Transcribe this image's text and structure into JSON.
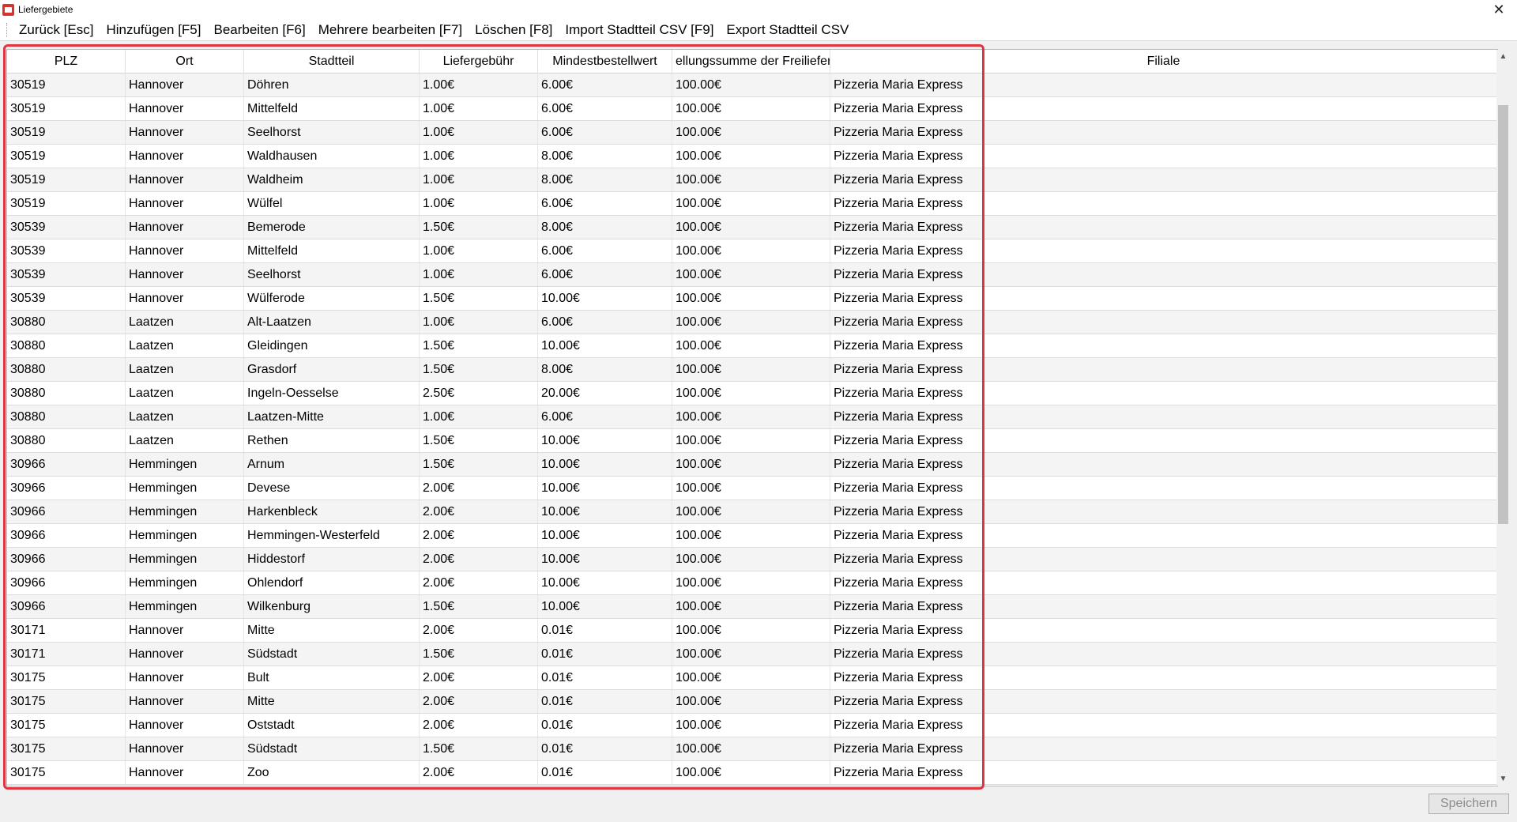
{
  "window": {
    "title": "Liefergebiete"
  },
  "menu": [
    "Zurück [Esc]",
    "Hinzufügen [F5]",
    "Bearbeiten [F6]",
    "Mehrere bearbeiten [F7]",
    "Löschen [F8]",
    "Import Stadtteil CSV [F9]",
    "Export Stadtteil CSV"
  ],
  "table": {
    "headers": [
      "PLZ",
      "Ort",
      "Stadtteil",
      "Liefergebühr",
      "Mindestbestellwert",
      "ellungssumme der Freiliefer",
      "Filiale"
    ],
    "rows": [
      [
        "30519",
        "Hannover",
        "Döhren",
        "1.00€",
        "6.00€",
        "100.00€",
        "Pizzeria Maria Express"
      ],
      [
        "30519",
        "Hannover",
        "Mittelfeld",
        "1.00€",
        "6.00€",
        "100.00€",
        "Pizzeria Maria Express"
      ],
      [
        "30519",
        "Hannover",
        "Seelhorst",
        "1.00€",
        "6.00€",
        "100.00€",
        "Pizzeria Maria Express"
      ],
      [
        "30519",
        "Hannover",
        "Waldhausen",
        "1.00€",
        "8.00€",
        "100.00€",
        "Pizzeria Maria Express"
      ],
      [
        "30519",
        "Hannover",
        "Waldheim",
        "1.00€",
        "8.00€",
        "100.00€",
        "Pizzeria Maria Express"
      ],
      [
        "30519",
        "Hannover",
        "Wülfel",
        "1.00€",
        "6.00€",
        "100.00€",
        "Pizzeria Maria Express"
      ],
      [
        "30539",
        "Hannover",
        "Bemerode",
        "1.50€",
        "8.00€",
        "100.00€",
        "Pizzeria Maria Express"
      ],
      [
        "30539",
        "Hannover",
        "Mittelfeld",
        "1.00€",
        "6.00€",
        "100.00€",
        "Pizzeria Maria Express"
      ],
      [
        "30539",
        "Hannover",
        "Seelhorst",
        "1.00€",
        "6.00€",
        "100.00€",
        "Pizzeria Maria Express"
      ],
      [
        "30539",
        "Hannover",
        "Wülferode",
        "1.50€",
        "10.00€",
        "100.00€",
        "Pizzeria Maria Express"
      ],
      [
        "30880",
        "Laatzen",
        "Alt-Laatzen",
        "1.00€",
        "6.00€",
        "100.00€",
        "Pizzeria Maria Express"
      ],
      [
        "30880",
        "Laatzen",
        "Gleidingen",
        "1.50€",
        "10.00€",
        "100.00€",
        "Pizzeria Maria Express"
      ],
      [
        "30880",
        "Laatzen",
        "Grasdorf",
        "1.50€",
        "8.00€",
        "100.00€",
        "Pizzeria Maria Express"
      ],
      [
        "30880",
        "Laatzen",
        "Ingeln-Oesselse",
        "2.50€",
        "20.00€",
        "100.00€",
        "Pizzeria Maria Express"
      ],
      [
        "30880",
        "Laatzen",
        "Laatzen-Mitte",
        "1.00€",
        "6.00€",
        "100.00€",
        "Pizzeria Maria Express"
      ],
      [
        "30880",
        "Laatzen",
        "Rethen",
        "1.50€",
        "10.00€",
        "100.00€",
        "Pizzeria Maria Express"
      ],
      [
        "30966",
        "Hemmingen",
        "Arnum",
        "1.50€",
        "10.00€",
        "100.00€",
        "Pizzeria Maria Express"
      ],
      [
        "30966",
        "Hemmingen",
        "Devese",
        "2.00€",
        "10.00€",
        "100.00€",
        "Pizzeria Maria Express"
      ],
      [
        "30966",
        "Hemmingen",
        "Harkenbleck",
        "2.00€",
        "10.00€",
        "100.00€",
        "Pizzeria Maria Express"
      ],
      [
        "30966",
        "Hemmingen",
        "Hemmingen-Westerfeld",
        "2.00€",
        "10.00€",
        "100.00€",
        "Pizzeria Maria Express"
      ],
      [
        "30966",
        "Hemmingen",
        "Hiddestorf",
        "2.00€",
        "10.00€",
        "100.00€",
        "Pizzeria Maria Express"
      ],
      [
        "30966",
        "Hemmingen",
        "Ohlendorf",
        "2.00€",
        "10.00€",
        "100.00€",
        "Pizzeria Maria Express"
      ],
      [
        "30966",
        "Hemmingen",
        "Wilkenburg",
        "1.50€",
        "10.00€",
        "100.00€",
        "Pizzeria Maria Express"
      ],
      [
        "30171",
        "Hannover",
        "Mitte",
        "2.00€",
        "0.01€",
        "100.00€",
        "Pizzeria Maria Express"
      ],
      [
        "30171",
        "Hannover",
        "Südstadt",
        "1.50€",
        "0.01€",
        "100.00€",
        "Pizzeria Maria Express"
      ],
      [
        "30175",
        "Hannover",
        "Bult",
        "2.00€",
        "0.01€",
        "100.00€",
        "Pizzeria Maria Express"
      ],
      [
        "30175",
        "Hannover",
        "Mitte",
        "2.00€",
        "0.01€",
        "100.00€",
        "Pizzeria Maria Express"
      ],
      [
        "30175",
        "Hannover",
        "Oststadt",
        "2.00€",
        "0.01€",
        "100.00€",
        "Pizzeria Maria Express"
      ],
      [
        "30175",
        "Hannover",
        "Südstadt",
        "1.50€",
        "0.01€",
        "100.00€",
        "Pizzeria Maria Express"
      ],
      [
        "30175",
        "Hannover",
        "Zoo",
        "2.00€",
        "0.01€",
        "100.00€",
        "Pizzeria Maria Express"
      ]
    ]
  },
  "footer": {
    "save_label": "Speichern"
  },
  "icons": {
    "app": "app-icon",
    "close": "close-icon"
  },
  "colors": {
    "highlight": "#e0353f",
    "row_alt": "#f4f4f4"
  }
}
